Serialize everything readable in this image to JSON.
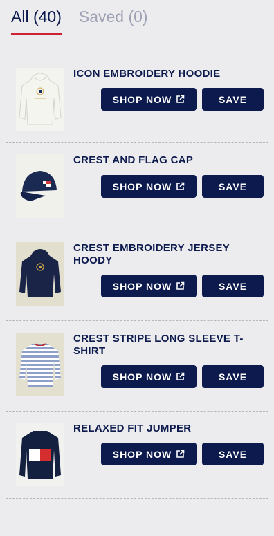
{
  "tabs": [
    {
      "label": "All (40)",
      "active": true
    },
    {
      "label": "Saved (0)",
      "active": false
    }
  ],
  "products": [
    {
      "title": "ICON EMBROIDERY HOODIE",
      "shop_label": "SHOP NOW",
      "save_label": "SAVE",
      "thumb_icon": "hoodie-white-icon"
    },
    {
      "title": "CREST AND FLAG CAP",
      "shop_label": "SHOP NOW",
      "save_label": "SAVE",
      "thumb_icon": "cap-icon"
    },
    {
      "title": "CREST EMBROIDERY JERSEY HOODY",
      "shop_label": "SHOP NOW",
      "save_label": "SAVE",
      "thumb_icon": "hoodie-navy-icon"
    },
    {
      "title": "CREST STRIPE LONG SLEEVE T-SHIRT",
      "shop_label": "SHOP NOW",
      "save_label": "SAVE",
      "thumb_icon": "striped-shirt-icon"
    },
    {
      "title": "RELAXED FIT JUMPER",
      "shop_label": "SHOP NOW",
      "save_label": "SAVE",
      "thumb_icon": "jumper-icon"
    }
  ],
  "colors": {
    "primary": "#0c1a4d",
    "accent": "#cc2233",
    "background": "#ececee",
    "inactive_tab": "#9ea2b4"
  }
}
